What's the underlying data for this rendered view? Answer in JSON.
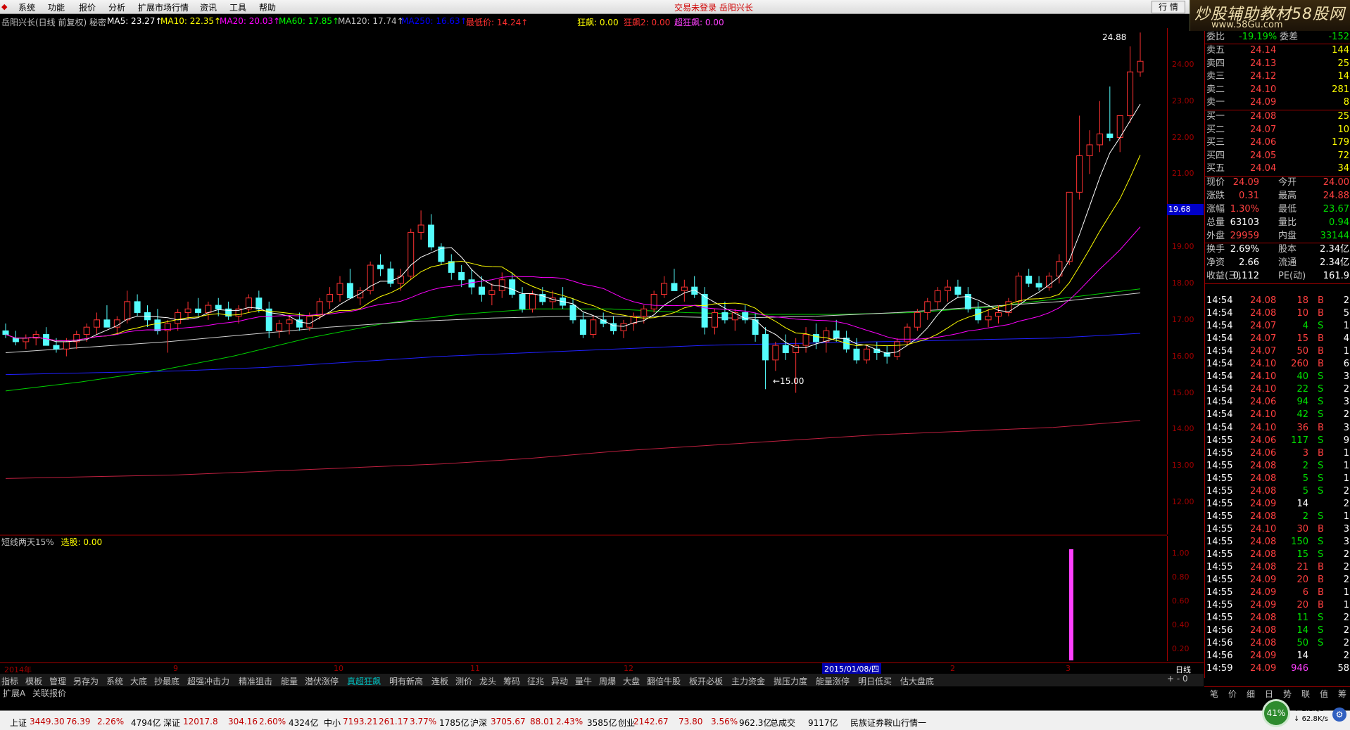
{
  "menubar": {
    "items": [
      "系统",
      "功能",
      "报价",
      "分析",
      "扩展市场行情",
      "资讯",
      "工具",
      "帮助"
    ],
    "center": "交易未登录   岳阳兴长",
    "quote_btn": "行 情"
  },
  "brand": {
    "title": "炒股辅助教材58股网",
    "url": "www.58Gu.com"
  },
  "ma_bar": {
    "stock": "岳阳兴长(日线 前复权) 秘密",
    "ma5": "MA5: 23.27↑",
    "ma10": "MA10: 22.35↑",
    "ma20": "MA20: 20.03↑",
    "ma60": "MA60: 17.85↑",
    "ma120": "MA120: 17.74↑",
    "ma250": "MA250: 16.63↑",
    "zuidi": "最低价: 14.24↑",
    "kuangbiao": "狂飙: 0.00",
    "kuangbiao2": "狂飙2: 0.00",
    "chaokuangbiao": "超狂飙: 0.00"
  },
  "chart_labels": {
    "high_mark": "24.88",
    "low_mark": "←15.00"
  },
  "price_axis": {
    "ticks": [
      "24.00",
      "23.00",
      "22.00",
      "21.00",
      "20.00",
      "19.00",
      "18.00",
      "17.00",
      "16.00",
      "15.00",
      "14.00",
      "13.00",
      "12.00"
    ],
    "current": "19.68"
  },
  "indicator": {
    "label": "短线两天15%",
    "value_label": "选股: 0.00",
    "ticks": [
      "1.00",
      "0.80",
      "0.60",
      "0.40",
      "0.20"
    ]
  },
  "timeline": {
    "labels": [
      "2014年",
      "9",
      "10",
      "11",
      "12",
      "2",
      "3"
    ],
    "date": "2015/01/08/四",
    "period": "日线"
  },
  "tabs": [
    "指标",
    "模板",
    "管理",
    "另存为",
    "系统",
    "大底",
    "抄最底",
    "超强冲击力",
    "精准狙击",
    "能量",
    "潜伏涨停",
    "真超狂飙",
    "明有新高",
    "连板",
    "测价",
    "龙头",
    "筹码",
    "征兆",
    "异动",
    "量牛",
    "周爆",
    "大盘",
    "翻倍牛股",
    "板开必板",
    "主力资金",
    "抛压力度",
    "能量涨停",
    "明日低买",
    "估大盘底"
  ],
  "tabs_active_index": 11,
  "tabs2": [
    "扩展A",
    "关联报价"
  ],
  "zoom": "+  -  0",
  "order_book": {
    "top_left": "委比",
    "top_left_val": "-19.19%",
    "top_right": "委差",
    "top_right_val": "-152",
    "sells": [
      {
        "label": "卖五",
        "price": "24.14",
        "vol": "144"
      },
      {
        "label": "卖四",
        "price": "24.13",
        "vol": "25"
      },
      {
        "label": "卖三",
        "price": "24.12",
        "vol": "14"
      },
      {
        "label": "卖二",
        "price": "24.10",
        "vol": "281"
      },
      {
        "label": "卖一",
        "price": "24.09",
        "vol": "8"
      }
    ],
    "buys": [
      {
        "label": "买一",
        "price": "24.08",
        "vol": "25"
      },
      {
        "label": "买二",
        "price": "24.07",
        "vol": "10"
      },
      {
        "label": "买三",
        "price": "24.06",
        "vol": "179"
      },
      {
        "label": "买四",
        "price": "24.05",
        "vol": "72"
      },
      {
        "label": "买五",
        "price": "24.04",
        "vol": "34"
      }
    ]
  },
  "stats": [
    {
      "l1": "现价",
      "v1": "24.09",
      "c1": "red",
      "l2": "今开",
      "v2": "24.00",
      "c2": "red"
    },
    {
      "l1": "涨跌",
      "v1": "0.31",
      "c1": "red",
      "l2": "最高",
      "v2": "24.88",
      "c2": "red"
    },
    {
      "l1": "涨幅",
      "v1": "1.30%",
      "c1": "red",
      "l2": "最低",
      "v2": "23.67",
      "c2": "grn"
    },
    {
      "l1": "总量",
      "v1": "63103",
      "c1": "wht",
      "l2": "量比",
      "v2": "0.94",
      "c2": "grn"
    },
    {
      "l1": "外盘",
      "v1": "29959",
      "c1": "red",
      "l2": "内盘",
      "v2": "33144",
      "c2": "grn"
    },
    {
      "l1": "换手",
      "v1": "2.69%",
      "c1": "wht",
      "l2": "股本",
      "v2": "2.34亿",
      "c2": "wht"
    },
    {
      "l1": "净资",
      "v1": "2.66",
      "c1": "wht",
      "l2": "流通",
      "v2": "2.34亿",
      "c2": "wht"
    },
    {
      "l1": "收益(三)",
      "v1": "0.112",
      "c1": "wht",
      "l2": "PE(动)",
      "v2": "161.9",
      "c2": "wht"
    }
  ],
  "ticks": [
    [
      "14:54",
      "24.08",
      "18",
      "B",
      "2"
    ],
    [
      "14:54",
      "24.08",
      "10",
      "B",
      "5"
    ],
    [
      "14:54",
      "24.07",
      "4",
      "S",
      "1"
    ],
    [
      "14:54",
      "24.07",
      "15",
      "B",
      "4"
    ],
    [
      "14:54",
      "24.07",
      "50",
      "B",
      "1"
    ],
    [
      "14:54",
      "24.10",
      "260",
      "B",
      "6"
    ],
    [
      "14:54",
      "24.10",
      "40",
      "S",
      "3"
    ],
    [
      "14:54",
      "24.10",
      "22",
      "S",
      "2"
    ],
    [
      "14:54",
      "24.06",
      "94",
      "S",
      "3"
    ],
    [
      "14:54",
      "24.10",
      "42",
      "S",
      "2"
    ],
    [
      "14:54",
      "24.10",
      "36",
      "B",
      "3"
    ],
    [
      "14:55",
      "24.06",
      "117",
      "S",
      "9"
    ],
    [
      "14:55",
      "24.06",
      "3",
      "B",
      "1"
    ],
    [
      "14:55",
      "24.08",
      "2",
      "S",
      "1"
    ],
    [
      "14:55",
      "24.08",
      "5",
      "S",
      "1"
    ],
    [
      "14:55",
      "24.08",
      "5",
      "S",
      "2"
    ],
    [
      "14:55",
      "24.09",
      "14",
      "",
      "2"
    ],
    [
      "14:55",
      "24.08",
      "2",
      "S",
      "1"
    ],
    [
      "14:55",
      "24.10",
      "30",
      "B",
      "3"
    ],
    [
      "14:55",
      "24.08",
      "150",
      "S",
      "3"
    ],
    [
      "14:55",
      "24.08",
      "15",
      "S",
      "2"
    ],
    [
      "14:55",
      "24.08",
      "21",
      "B",
      "2"
    ],
    [
      "14:55",
      "24.09",
      "20",
      "B",
      "2"
    ],
    [
      "14:55",
      "24.09",
      "6",
      "B",
      "1"
    ],
    [
      "14:55",
      "24.09",
      "20",
      "B",
      "1"
    ],
    [
      "14:55",
      "24.08",
      "11",
      "S",
      "2"
    ],
    [
      "14:56",
      "24.08",
      "14",
      "S",
      "2"
    ],
    [
      "14:56",
      "24.08",
      "50",
      "S",
      "2"
    ],
    [
      "14:56",
      "24.09",
      "14",
      "",
      "2"
    ],
    [
      "14:59",
      "24.09",
      "946",
      "",
      "58"
    ]
  ],
  "panel_tabs": [
    "笔",
    "价",
    "细",
    "日",
    "势",
    "联",
    "值",
    "筹"
  ],
  "statusbar": {
    "items": [
      "上证",
      "3449.30",
      "76.39",
      "2.26%",
      "4794亿",
      "深证",
      "12017.8",
      "304.16",
      "2.60%",
      "4324亿",
      "中小",
      "7193.21",
      "261.17",
      "3.77%",
      "1785亿",
      "沪深",
      "3705.67",
      "88.01",
      "2.43%",
      "3585亿",
      "创业",
      "2142.67",
      "73.80",
      "3.56%",
      "962.3亿",
      "总成交",
      "9117亿",
      "民族证券鞍山行情一"
    ],
    "gauge": "41%",
    "net_up": "2.1K/s",
    "net_down": "62.8K/s"
  },
  "chart_data": {
    "type": "candlestick",
    "x_labels": [
      "2014年",
      "9",
      "10",
      "11",
      "12",
      "2015/01/08/四",
      "2",
      "3"
    ],
    "ylim": [
      11.5,
      25.0
    ],
    "ohlc_approx": [
      [
        16.7,
        16.9,
        16.5,
        16.6
      ],
      [
        16.5,
        16.7,
        16.3,
        16.4
      ],
      [
        16.4,
        16.6,
        16.2,
        16.5
      ],
      [
        16.5,
        16.7,
        16.3,
        16.6
      ],
      [
        16.6,
        16.8,
        16.4,
        16.3
      ],
      [
        16.3,
        16.5,
        16.1,
        16.2
      ],
      [
        16.2,
        16.5,
        16.0,
        16.4
      ],
      [
        16.4,
        16.7,
        16.2,
        16.6
      ],
      [
        16.6,
        16.9,
        16.4,
        16.8
      ],
      [
        16.8,
        17.2,
        16.6,
        17.0
      ],
      [
        17.0,
        17.4,
        16.8,
        16.8
      ],
      [
        16.8,
        17.1,
        16.6,
        17.0
      ],
      [
        17.0,
        17.8,
        16.9,
        17.5
      ],
      [
        17.5,
        17.7,
        17.1,
        17.2
      ],
      [
        17.2,
        17.4,
        16.8,
        17.0
      ],
      [
        17.0,
        17.3,
        16.6,
        16.7
      ],
      [
        16.7,
        17.0,
        16.1,
        16.9
      ],
      [
        16.9,
        17.3,
        16.7,
        17.2
      ],
      [
        17.2,
        17.5,
        17.0,
        17.3
      ],
      [
        17.3,
        17.6,
        17.1,
        17.2
      ],
      [
        17.2,
        17.5,
        17.0,
        17.4
      ],
      [
        17.4,
        17.6,
        17.1,
        17.3
      ],
      [
        17.3,
        17.5,
        17.0,
        17.1
      ],
      [
        17.1,
        17.4,
        16.9,
        17.3
      ],
      [
        17.3,
        17.7,
        17.2,
        17.6
      ],
      [
        17.6,
        17.8,
        17.2,
        17.3
      ],
      [
        17.3,
        17.5,
        16.5,
        16.7
      ],
      [
        16.7,
        17.0,
        16.5,
        16.9
      ],
      [
        16.9,
        17.1,
        16.6,
        17.0
      ],
      [
        17.0,
        17.2,
        16.7,
        16.8
      ],
      [
        16.8,
        17.2,
        16.7,
        17.1
      ],
      [
        17.1,
        17.6,
        17.0,
        17.5
      ],
      [
        17.5,
        17.9,
        17.3,
        17.7
      ],
      [
        17.7,
        18.2,
        17.5,
        18.0
      ],
      [
        18.0,
        18.4,
        17.8,
        17.6
      ],
      [
        17.6,
        17.9,
        17.4,
        17.8
      ],
      [
        17.8,
        18.6,
        17.7,
        18.5
      ],
      [
        18.5,
        18.8,
        18.2,
        18.4
      ],
      [
        18.4,
        18.6,
        17.9,
        18.0
      ],
      [
        18.0,
        18.4,
        17.8,
        18.2
      ],
      [
        18.2,
        19.5,
        18.1,
        19.4
      ],
      [
        19.4,
        20.0,
        19.2,
        19.6
      ],
      [
        19.6,
        19.9,
        18.9,
        19.0
      ],
      [
        19.0,
        19.1,
        18.5,
        18.6
      ],
      [
        18.6,
        18.8,
        18.1,
        18.3
      ],
      [
        18.3,
        18.5,
        17.9,
        18.1
      ],
      [
        18.1,
        18.4,
        17.7,
        17.9
      ],
      [
        17.9,
        18.2,
        17.5,
        17.7
      ],
      [
        17.7,
        18.0,
        17.4,
        17.8
      ],
      [
        17.8,
        18.3,
        17.6,
        18.1
      ],
      [
        18.1,
        18.3,
        17.6,
        17.7
      ],
      [
        17.7,
        17.9,
        17.2,
        17.3
      ],
      [
        17.3,
        17.8,
        17.2,
        17.7
      ],
      [
        17.7,
        17.9,
        17.4,
        17.5
      ],
      [
        17.5,
        17.8,
        17.3,
        17.6
      ],
      [
        17.6,
        17.9,
        17.3,
        17.4
      ],
      [
        17.4,
        17.6,
        16.9,
        17.0
      ],
      [
        17.0,
        17.2,
        16.5,
        16.6
      ],
      [
        16.6,
        17.1,
        16.5,
        17.0
      ],
      [
        17.0,
        17.2,
        16.8,
        16.9
      ],
      [
        16.9,
        17.1,
        16.6,
        16.7
      ],
      [
        16.7,
        17.0,
        16.5,
        16.9
      ],
      [
        16.9,
        17.2,
        16.7,
        17.1
      ],
      [
        17.1,
        17.4,
        16.9,
        17.3
      ],
      [
        17.3,
        17.8,
        17.2,
        17.7
      ],
      [
        17.7,
        18.2,
        17.6,
        18.0
      ],
      [
        18.0,
        18.4,
        17.8,
        17.8
      ],
      [
        17.8,
        18.1,
        17.5,
        17.9
      ],
      [
        17.9,
        18.2,
        17.6,
        17.7
      ],
      [
        17.7,
        17.9,
        16.6,
        16.8
      ],
      [
        16.8,
        17.3,
        16.6,
        17.2
      ],
      [
        17.2,
        17.5,
        16.9,
        17.0
      ],
      [
        17.0,
        17.3,
        16.7,
        17.2
      ],
      [
        17.2,
        17.4,
        16.9,
        17.0
      ],
      [
        17.0,
        17.2,
        16.4,
        16.6
      ],
      [
        16.6,
        16.8,
        15.1,
        15.9
      ],
      [
        15.9,
        16.4,
        15.6,
        16.3
      ],
      [
        16.3,
        16.6,
        15.9,
        16.1
      ],
      [
        16.1,
        16.5,
        15.0,
        16.3
      ],
      [
        16.3,
        16.8,
        16.1,
        16.6
      ],
      [
        16.6,
        16.9,
        16.2,
        16.4
      ],
      [
        16.4,
        16.8,
        16.1,
        16.7
      ],
      [
        16.7,
        17.0,
        16.4,
        16.5
      ],
      [
        16.5,
        16.7,
        16.1,
        16.2
      ],
      [
        16.2,
        16.5,
        15.8,
        15.9
      ],
      [
        15.9,
        16.3,
        15.8,
        16.2
      ],
      [
        16.2,
        16.4,
        15.9,
        16.1
      ],
      [
        16.1,
        16.3,
        15.8,
        16.0
      ],
      [
        16.0,
        16.5,
        15.9,
        16.4
      ],
      [
        16.4,
        16.9,
        16.3,
        16.8
      ],
      [
        16.8,
        17.3,
        16.7,
        17.2
      ],
      [
        17.2,
        17.6,
        17.0,
        17.5
      ],
      [
        17.5,
        17.9,
        17.3,
        17.8
      ],
      [
        17.8,
        18.1,
        17.5,
        17.9
      ],
      [
        17.9,
        18.1,
        17.6,
        17.7
      ],
      [
        17.7,
        17.9,
        17.2,
        17.3
      ],
      [
        17.3,
        17.5,
        16.9,
        17.0
      ],
      [
        17.0,
        17.3,
        16.8,
        17.1
      ],
      [
        17.1,
        17.4,
        16.9,
        17.2
      ],
      [
        17.2,
        17.6,
        17.1,
        17.5
      ],
      [
        17.5,
        18.3,
        17.4,
        18.2
      ],
      [
        18.2,
        18.4,
        17.9,
        18.0
      ],
      [
        18.0,
        18.2,
        17.8,
        17.9
      ],
      [
        17.9,
        18.3,
        17.8,
        18.2
      ],
      [
        18.2,
        18.8,
        18.0,
        18.6
      ],
      [
        18.6,
        20.5,
        18.5,
        20.5
      ],
      [
        20.5,
        22.6,
        20.3,
        21.5
      ],
      [
        21.5,
        22.2,
        21.0,
        21.8
      ],
      [
        21.8,
        23.0,
        21.6,
        22.1
      ],
      [
        22.1,
        23.4,
        21.9,
        22.0
      ],
      [
        22.0,
        22.5,
        21.6,
        22.6
      ],
      [
        22.6,
        24.5,
        22.4,
        23.8
      ],
      [
        23.8,
        24.88,
        23.67,
        24.09
      ]
    ]
  }
}
